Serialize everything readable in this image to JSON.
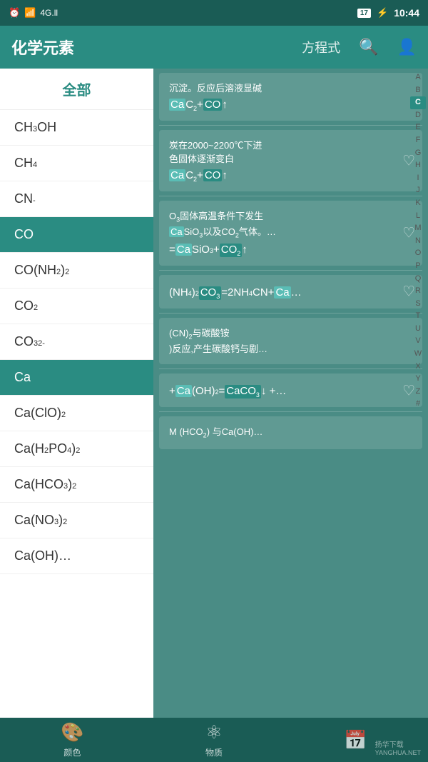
{
  "statusBar": {
    "alarm": "⏰",
    "wifi": "📶",
    "signal": "4G",
    "battery": "17",
    "charging": "⚡",
    "time": "10:44"
  },
  "header": {
    "title": "化学元素",
    "subtitle": "方程式",
    "searchIcon": "🔍",
    "profileIcon": "👤"
  },
  "sidebar": {
    "allLabel": "全部",
    "items": [
      {
        "id": "CH3OH",
        "label": "CH₃OH",
        "html": "CH<sub>3</sub>OH",
        "active": false
      },
      {
        "id": "CH4",
        "label": "CH₄",
        "html": "CH<sub>4</sub>",
        "active": false
      },
      {
        "id": "CN-",
        "label": "CN⁻",
        "html": "CN<sup>-</sup>",
        "active": false
      },
      {
        "id": "CO",
        "label": "CO",
        "html": "CO",
        "active": true
      },
      {
        "id": "CONH2",
        "label": "CO(NH₂)₂",
        "html": "CO(NH<sub>2</sub>)<sub>2</sub>",
        "active": false
      },
      {
        "id": "CO2",
        "label": "CO₂",
        "html": "CO<sub>2</sub>",
        "active": false
      },
      {
        "id": "CO32-",
        "label": "CO₃²⁻",
        "html": "CO<sub>3</sub><sup>2-</sup>",
        "active": false
      },
      {
        "id": "Ca",
        "label": "Ca",
        "html": "Ca",
        "active": true
      },
      {
        "id": "CaClO2",
        "label": "Ca(ClO)₂",
        "html": "Ca(ClO)<sub>2</sub>",
        "active": false
      },
      {
        "id": "CaH2PO4",
        "label": "Ca(H₂PO₄)₂",
        "html": "Ca(H<sub>2</sub>PO<sub>4</sub>)<sub>2</sub>",
        "active": false
      },
      {
        "id": "CaHCO3",
        "label": "Ca(HCO₃)₂",
        "html": "Ca(HCO<sub>3</sub>)<sub>2</sub>",
        "active": false
      },
      {
        "id": "CaNO3",
        "label": "Ca(NO₃)₂",
        "html": "Ca(NO<sub>3</sub>)<sub>2</sub>",
        "active": false
      },
      {
        "id": "CaOH",
        "label": "Ca(OH)…",
        "html": "Ca(OH)…",
        "active": false
      }
    ]
  },
  "alphabet": [
    "A",
    "B",
    "C",
    "D",
    "E",
    "F",
    "G",
    "H",
    "I",
    "J",
    "K",
    "L",
    "M",
    "N",
    "O",
    "P",
    "Q",
    "R",
    "S",
    "T",
    "U",
    "V",
    "W",
    "X",
    "Y",
    "Z",
    "#"
  ],
  "activeAlpha": "C",
  "contentCards": [
    {
      "id": "card1",
      "text": "沉淀。反应后溶液显碱",
      "formula": "CaC₂+CO↑",
      "hasHeart": false,
      "type": "formula-only"
    },
    {
      "id": "card2",
      "text": "炭在2000~2200℃下进\n色固体逐渐变白",
      "formula": "CaC₂+CO↑",
      "hasHeart": true,
      "type": "text-formula"
    },
    {
      "id": "card3",
      "text": "O₃固体高温条件下发生\nCaSiO₃以及CO₂气体。…",
      "formula": "=CaSiO₃+CO₂↑",
      "hasHeart": true,
      "type": "text-formula"
    },
    {
      "id": "card4",
      "text": "NH₄)₂CO₃=2NH₄CN+Ca…",
      "formula": "",
      "hasHeart": true,
      "type": "formula-line"
    },
    {
      "id": "card5",
      "text": "(CN)₂与碳酸铵\n)反应,产生碳酸钙与剧…",
      "formula": "",
      "hasHeart": false,
      "type": "text-only"
    },
    {
      "id": "card6",
      "text": "+Ca(OH)₂=CaCO₃↓+…",
      "formula": "",
      "hasHeart": true,
      "type": "formula-line"
    },
    {
      "id": "card7",
      "text": "M (HCO₂) 与Ca(OH)…",
      "formula": "",
      "hasHeart": false,
      "type": "text-only"
    }
  ],
  "bottomNav": {
    "items": [
      {
        "id": "color",
        "icon": "🎨",
        "label": "颜色"
      },
      {
        "id": "matter",
        "icon": "⚛",
        "label": "物质"
      },
      {
        "id": "calendar",
        "icon": "📅",
        "label": ""
      }
    ]
  },
  "watermark": "扬华下载\nYANGHUA.NET"
}
